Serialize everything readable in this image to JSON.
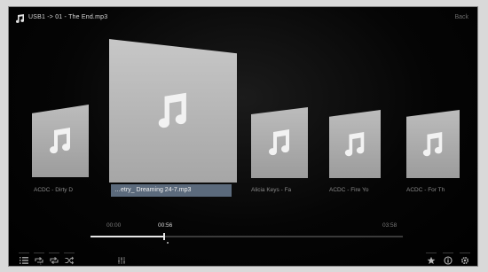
{
  "header": {
    "title": "USB1 -> 01 - The End.mp3",
    "back_label": "Back"
  },
  "covers": [
    {
      "label": "ACDC - Dirty D",
      "icon": "music-note-icon"
    },
    {
      "label": "…etry_ Dreaming 24-7.mp3",
      "icon": "music-note-icon",
      "selected": true
    },
    {
      "label": "Alicia Keys - Fa",
      "icon": "music-note-icon"
    },
    {
      "label": "ACDC - Fire Yo",
      "icon": "music-note-icon"
    },
    {
      "label": "ACDC - For Th",
      "icon": "music-note-icon"
    }
  ],
  "playback": {
    "start_time": "00:00",
    "current_time": "00:56",
    "end_time": "03:58",
    "progress": 0.235
  },
  "bottom_icons": {
    "left": [
      "list-icon",
      "repeat-one-icon",
      "repeat-icon",
      "shuffle-icon",
      "equalizer-icon"
    ],
    "right": [
      "star-icon",
      "info-icon",
      "settings-icon"
    ]
  },
  "colors": {
    "background": "#000000",
    "cover": "#a8a8a8",
    "selected_label_bg": "#5b6a7c",
    "progress": "#e6e6e6"
  }
}
